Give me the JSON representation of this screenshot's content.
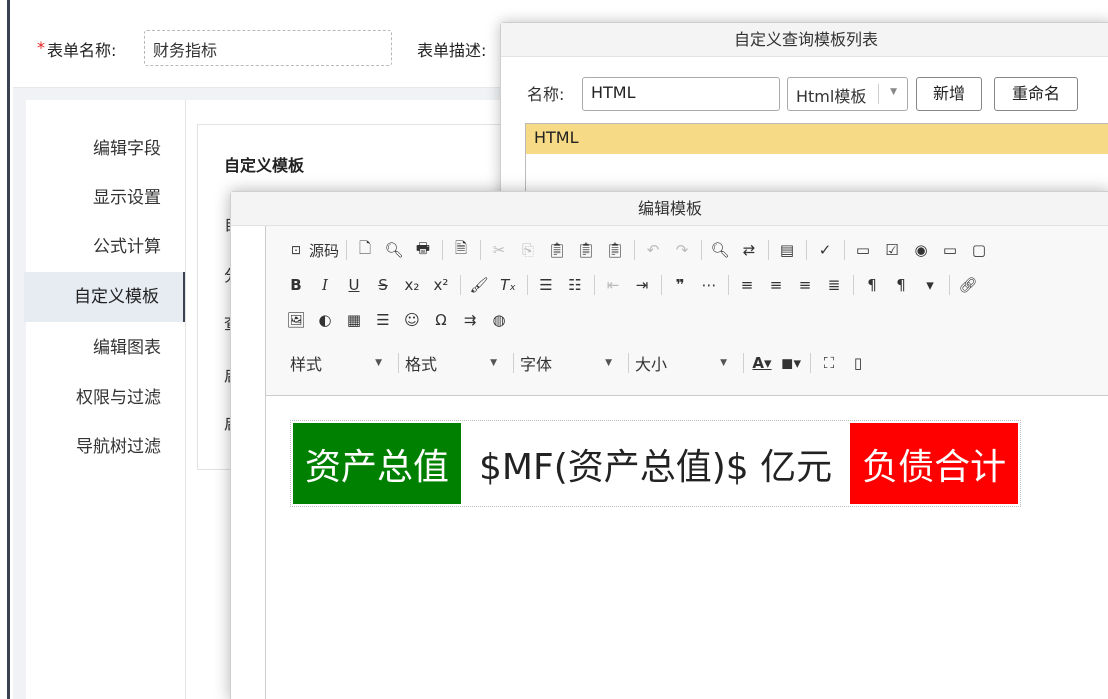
{
  "form": {
    "required_mark": "*",
    "name_label": "表单名称:",
    "name_value": "财务指标",
    "desc_label": "表单描述:"
  },
  "sidebar": {
    "items": [
      {
        "label": "编辑字段"
      },
      {
        "label": "显示设置"
      },
      {
        "label": "公式计算"
      },
      {
        "label": "自定义模板",
        "active": true
      },
      {
        "label": "编辑图表"
      },
      {
        "label": "权限与过滤"
      },
      {
        "label": "导航树过滤"
      }
    ]
  },
  "main": {
    "title": "自定义模板",
    "clipped_chars": [
      "自",
      "分",
      "查",
      "启",
      "启"
    ]
  },
  "query_dialog": {
    "title": "自定义查询模板列表",
    "name_label": "名称:",
    "name_value": "HTML",
    "type_select": "Html模板",
    "add_button": "新增",
    "rename_button": "重命名",
    "list_items": [
      "HTML"
    ]
  },
  "edit_dialog": {
    "title": "编辑模板",
    "source_button": "源码",
    "combos": {
      "style": "样式",
      "format": "格式",
      "font": "字体",
      "size": "大小"
    },
    "template_cells": {
      "cell1": "资产总值",
      "cell2": "$MF(资产总值)$ 亿元",
      "cell3": "负债合计"
    }
  },
  "colors": {
    "active_bg": "#e7ebf2",
    "list_selected": "#f7da86",
    "cell_green": "#008000",
    "cell_red": "#ff0000"
  }
}
